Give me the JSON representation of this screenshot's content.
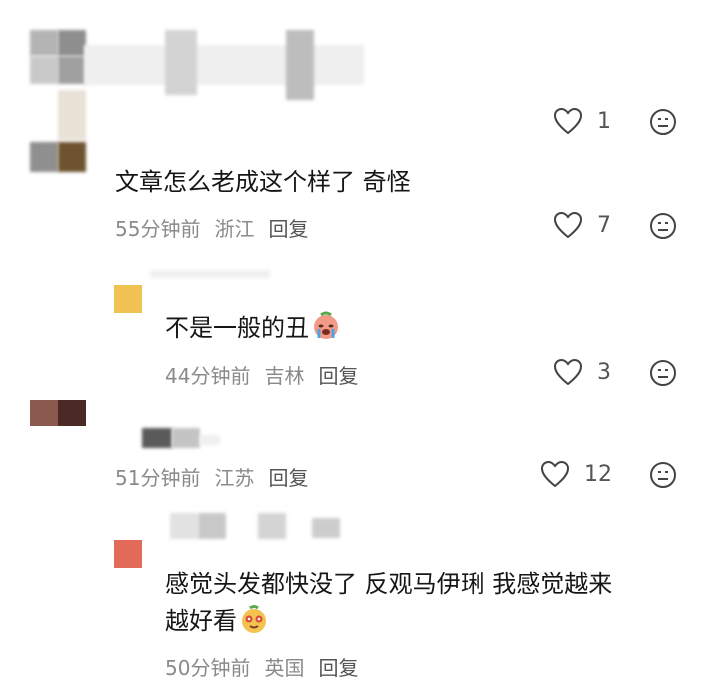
{
  "comments": [
    {
      "text": "文章怎么老成这个样了 奇怪",
      "time": "55分钟前",
      "location": "浙江",
      "reply_label": "回复",
      "likes": "7"
    },
    {
      "text": "不是一般的丑",
      "time": "44分钟前",
      "location": "吉林",
      "reply_label": "回复",
      "likes": "3"
    },
    {
      "text": "",
      "time": "51分钟前",
      "location": "江苏",
      "reply_label": "回复",
      "likes": "12"
    },
    {
      "text_line1": "感觉头发都快没了 反观马伊琍 我感觉越来",
      "text_line2": "越好看",
      "time": "50分钟前",
      "location": "英国",
      "reply_label": "回复"
    }
  ],
  "top_row": {
    "likes": "1"
  },
  "icons": {
    "like": "heart-outline-icon",
    "more": "face-menu-icon",
    "emoji_crying": "crying-emoji-icon",
    "emoji_happy": "happy-emoji-icon"
  },
  "colors": {
    "avatar_yellow": "#f1c152",
    "avatar_brown": "#8a5a4e",
    "avatar_red": "#e26b5a",
    "meta_gray": "#8a8a8a"
  }
}
